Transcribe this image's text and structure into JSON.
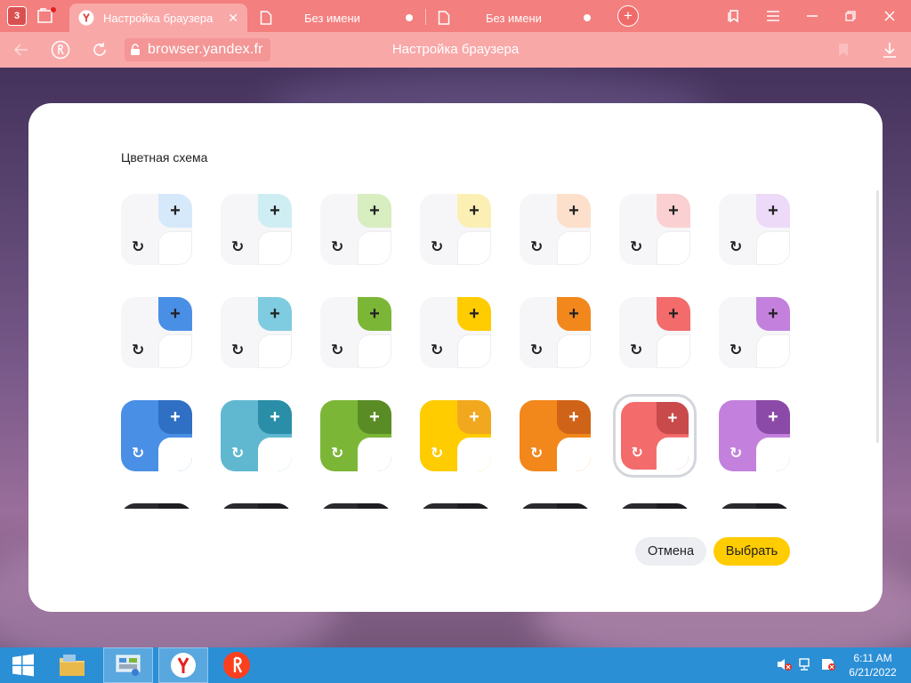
{
  "tabstrip": {
    "tab_count": "3",
    "tabs": [
      {
        "label": "Настройка браузера",
        "icon": "yandex-icon",
        "active": true
      },
      {
        "label": "Без имени",
        "icon": "document-icon",
        "active": false
      },
      {
        "label": "Без имени",
        "icon": "document-icon",
        "active": false
      }
    ],
    "add_tab_symbol": "+",
    "window_controls": {
      "collections_icon": "collections-icon",
      "menu_icon": "menu-icon",
      "minimize_icon": "minimize-icon",
      "restore_icon": "restore-icon",
      "close_icon": "close-icon"
    }
  },
  "addressbar": {
    "url": "browser.yandex.fr",
    "page_title": "Настройка браузера"
  },
  "dialog": {
    "title": "Цветная схема",
    "cancel_label": "Отмена",
    "ok_label": "Выбрать",
    "selected": {
      "row": 2,
      "col": 5
    },
    "palette_rows": [
      [
        {
          "main": "#ffffff",
          "accent": "#d6e9fb"
        },
        {
          "main": "#ffffff",
          "accent": "#cfeef3"
        },
        {
          "main": "#ffffff",
          "accent": "#d8edc0"
        },
        {
          "main": "#ffffff",
          "accent": "#fbefb4"
        },
        {
          "main": "#ffffff",
          "accent": "#fde0cc"
        },
        {
          "main": "#ffffff",
          "accent": "#fbd0d2"
        },
        {
          "main": "#ffffff",
          "accent": "#ecdaf8"
        }
      ],
      [
        {
          "main": "#ffffff",
          "accent": "#4a8fe6"
        },
        {
          "main": "#ffffff",
          "accent": "#7fcbe0"
        },
        {
          "main": "#ffffff",
          "accent": "#7cb637"
        },
        {
          "main": "#ffffff",
          "accent": "#ffcc00"
        },
        {
          "main": "#ffffff",
          "accent": "#f2871b"
        },
        {
          "main": "#ffffff",
          "accent": "#f36b6b"
        },
        {
          "main": "#ffffff",
          "accent": "#c381dd"
        }
      ],
      [
        {
          "main": "#4a8fe6",
          "accent": "#2f6fc4"
        },
        {
          "main": "#5fb8d0",
          "accent": "#2a8ea8"
        },
        {
          "main": "#7cb637",
          "accent": "#5a8c26"
        },
        {
          "main": "#ffcc00",
          "accent": "#f2a81e"
        },
        {
          "main": "#f2871b",
          "accent": "#cf6418"
        },
        {
          "main": "#f36b6b",
          "accent": "#c84a4a"
        },
        {
          "main": "#c381dd",
          "accent": "#8c4aa8"
        }
      ],
      [
        {
          "main": "#2a2a2e",
          "accent": "#1e1e22"
        },
        {
          "main": "#2a2a2e",
          "accent": "#1e1e22"
        },
        {
          "main": "#2a2a2e",
          "accent": "#1e1e22"
        },
        {
          "main": "#2a2a2e",
          "accent": "#1e1e22"
        },
        {
          "main": "#2a2a2e",
          "accent": "#1e1e22"
        },
        {
          "main": "#2a2a2e",
          "accent": "#1e1e22"
        },
        {
          "main": "#2a2a2e",
          "accent": "#1e1e22"
        }
      ]
    ]
  },
  "taskbar": {
    "time": "6:11 AM",
    "date": "6/21/2022"
  },
  "colors": {
    "tabstrip": "#f37f7f",
    "addressbar": "#f9a8a8",
    "taskbar": "#2b8fd6",
    "ok_button": "#ffcc00"
  }
}
